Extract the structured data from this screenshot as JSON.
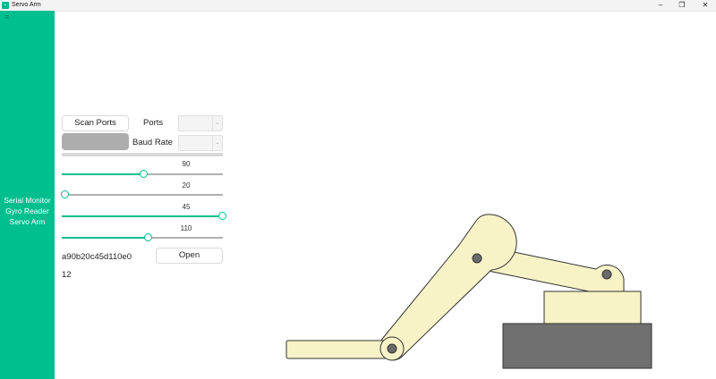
{
  "window": {
    "title": "Servo Arm",
    "app_icon": "servo-app-icon"
  },
  "sidebar": {
    "menu_icon": "hamburger-icon",
    "items": [
      {
        "label": "Serial Monitor"
      },
      {
        "label": "Gyro Reader"
      },
      {
        "label": "Servo Arm"
      }
    ]
  },
  "controls": {
    "scan_ports_label": "Scan Ports",
    "ports_label": "Ports",
    "baud_rate_label": "Baud Rate",
    "ports_value": "",
    "baud_rate_value": "",
    "connect_label": ""
  },
  "sliders": [
    {
      "value": "90",
      "level": 0.5
    },
    {
      "value": "20",
      "level": 0.0
    },
    {
      "value": "45",
      "level": 1.0
    },
    {
      "value": "110",
      "level": 0.53
    }
  ],
  "info": {
    "device_id": "a90b20c45d110e0",
    "open_label": "Open",
    "count": "12"
  },
  "colors": {
    "accent": "#00bf8f",
    "arm_fill": "#f7f3c6",
    "base_fill": "#707070"
  }
}
